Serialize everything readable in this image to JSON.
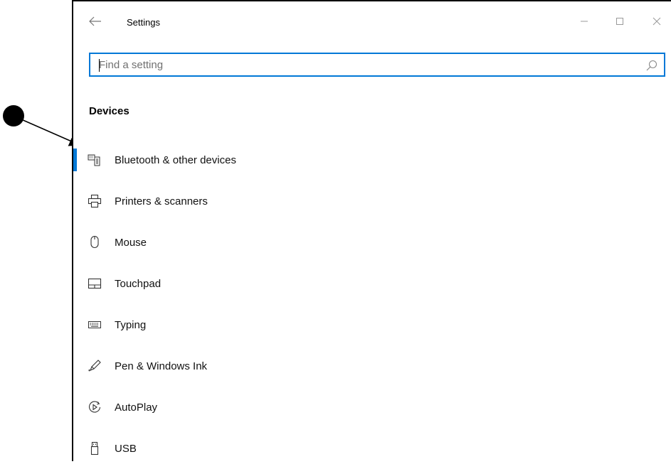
{
  "window": {
    "title": "Settings",
    "controls": {
      "minimize": "minimize-icon",
      "maximize": "maximize-icon",
      "close": "close-icon"
    }
  },
  "search": {
    "placeholder": "Find a setting",
    "value": ""
  },
  "section": {
    "title": "Devices"
  },
  "accent_color": "#0078d7",
  "nav": {
    "items": [
      {
        "label": "Bluetooth & other devices",
        "icon": "bluetooth-devices-icon",
        "selected": true
      },
      {
        "label": "Printers & scanners",
        "icon": "printer-icon",
        "selected": false
      },
      {
        "label": "Mouse",
        "icon": "mouse-icon",
        "selected": false
      },
      {
        "label": "Touchpad",
        "icon": "touchpad-icon",
        "selected": false
      },
      {
        "label": "Typing",
        "icon": "keyboard-icon",
        "selected": false
      },
      {
        "label": "Pen & Windows Ink",
        "icon": "pen-icon",
        "selected": false
      },
      {
        "label": "AutoPlay",
        "icon": "autoplay-icon",
        "selected": false
      },
      {
        "label": "USB",
        "icon": "usb-icon",
        "selected": false
      }
    ]
  }
}
